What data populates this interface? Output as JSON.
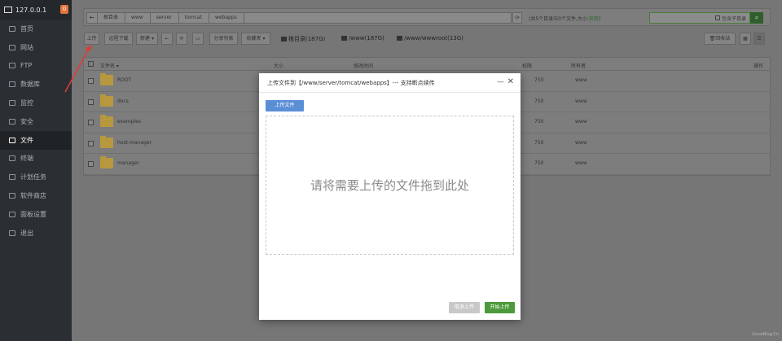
{
  "sidebar": {
    "ip": "127.0.0.1",
    "badge": "0",
    "items": [
      {
        "label": "首页",
        "icon": "home-icon"
      },
      {
        "label": "网站",
        "icon": "globe-icon"
      },
      {
        "label": "FTP",
        "icon": "ftp-icon"
      },
      {
        "label": "数据库",
        "icon": "database-icon"
      },
      {
        "label": "监控",
        "icon": "monitor-icon"
      },
      {
        "label": "安全",
        "icon": "shield-icon"
      },
      {
        "label": "文件",
        "icon": "folder-icon"
      },
      {
        "label": "终端",
        "icon": "terminal-icon"
      },
      {
        "label": "计划任务",
        "icon": "clock-icon"
      },
      {
        "label": "软件商店",
        "icon": "store-icon"
      },
      {
        "label": "面板设置",
        "icon": "gear-icon"
      },
      {
        "label": "退出",
        "icon": "logout-icon"
      }
    ],
    "active_index": 6
  },
  "breadcrumb": {
    "back": "←",
    "segments": [
      "根目录",
      "www",
      "server",
      "tomcat",
      "webapps"
    ]
  },
  "counts": {
    "prefix": "(共5个目录与0个文件,大小:",
    "link": "获取",
    "suffix": ")"
  },
  "search": {
    "checkbox_label": "包含子目录",
    "button": "⌕"
  },
  "toolbar": {
    "upload": "上传",
    "remote_download": "远程下载",
    "new": "新建 ▾",
    "back": "←",
    "refresh": "⟳",
    "terminal": "▭",
    "share_list": "分享列表",
    "favorites": "收藏夹 ▾",
    "disks": [
      "根目录(187G)",
      "/www(187G)",
      "/www/wwwroot(13G)"
    ],
    "recycle": "回收站"
  },
  "table": {
    "headers": {
      "name": "文件名 ▾",
      "size": "大小",
      "mtime": "修改时间",
      "perm": "权限",
      "owner": "所有者",
      "op": "操作"
    },
    "rows": [
      {
        "name": "ROOT",
        "perm": "750",
        "owner": "www"
      },
      {
        "name": "docs",
        "perm": "750",
        "owner": "www"
      },
      {
        "name": "examples",
        "perm": "750",
        "owner": "www"
      },
      {
        "name": "host-manager",
        "perm": "750",
        "owner": "www"
      },
      {
        "name": "manager",
        "perm": "750",
        "owner": "www"
      }
    ]
  },
  "dialog": {
    "title": "上传文件到【/www/server/tomcat/webapps】--- 支持断点续传",
    "minimize": "—",
    "close": "✕",
    "upload_button": "上传文件",
    "dropzone_text": "请将需要上传的文件拖到此处",
    "cancel": "取消上传",
    "start": "开始上传"
  },
  "watermark": "LinuxBlog.Cn",
  "colors": {
    "accent_green": "#4c9a3b",
    "upload_blue": "#5a8fd6",
    "arrow_red": "#e53935"
  }
}
